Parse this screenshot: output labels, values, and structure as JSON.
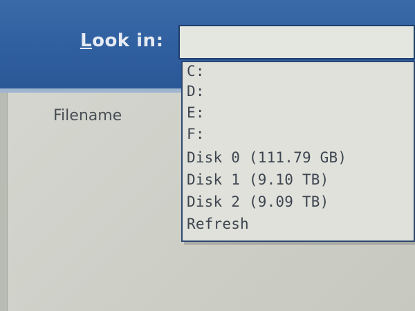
{
  "dialog": {
    "look_in_label_first": "L",
    "look_in_label_rest": "ook in:",
    "filename_label": "Filename",
    "look_in_value": ""
  },
  "dropdown": {
    "items": [
      {
        "label": "C:"
      },
      {
        "label": "D:"
      },
      {
        "label": "E:"
      },
      {
        "label": "F:"
      },
      {
        "label": "Disk 0 (111.79 GB)"
      },
      {
        "label": "Disk 1 (9.10 TB)"
      },
      {
        "label": "Disk 2 (9.09 TB)"
      },
      {
        "label": "Refresh"
      }
    ]
  },
  "colors": {
    "header_blue": "#2f5e9f",
    "content_gray": "#c9cbc2",
    "border_dark_blue": "#1e3d6b"
  }
}
